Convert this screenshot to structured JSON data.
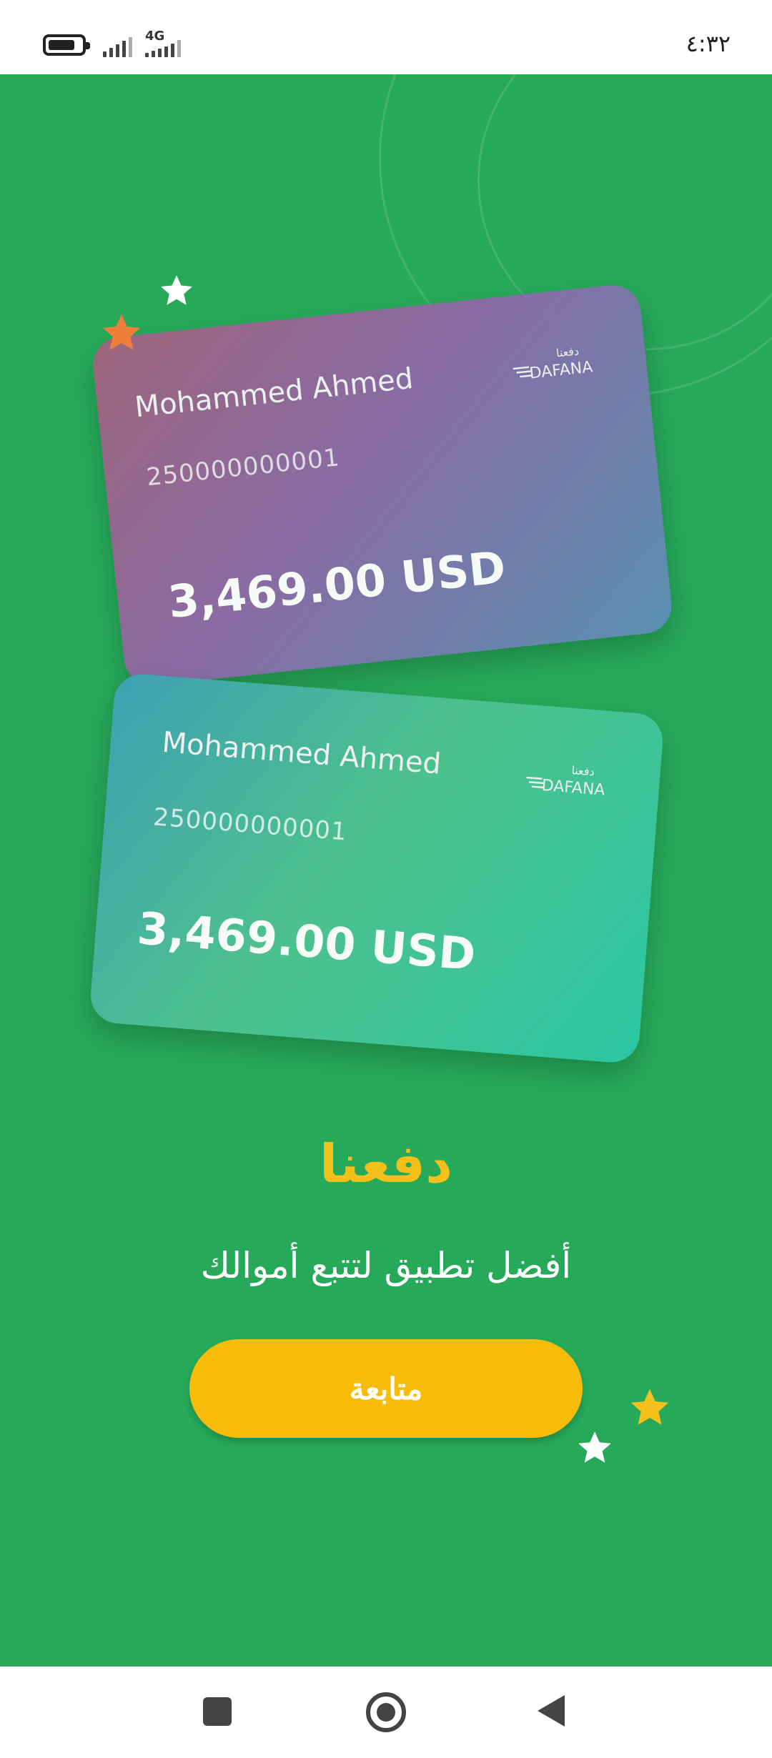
{
  "status_bar": {
    "network": "4G",
    "time": "٤:٣٢"
  },
  "cards": [
    {
      "holder_name": "Mohammed Ahmed",
      "account_number": "250000000001",
      "balance": "3,469.00 USD",
      "logo_text": "DAFANA",
      "logo_arabic": "دفعنا"
    },
    {
      "holder_name": "Mohammed Ahmed",
      "account_number": "250000000001",
      "balance": "3,469.00 USD",
      "logo_text": "DAFANA",
      "logo_arabic": "دفعنا"
    }
  ],
  "onboarding": {
    "title": "دفعنا",
    "tagline": "أفضل تطبيق لتتبع أموالك",
    "continue_label": "متابعة"
  },
  "colors": {
    "background": "#27a95a",
    "accent": "#f8bc0b",
    "title": "#f5c01a"
  },
  "icons": {
    "stars": [
      "white-star-icon",
      "orange-star-icon",
      "yellow-star-icon",
      "white-star-icon"
    ],
    "nav": [
      "recent-apps-icon",
      "home-icon",
      "back-icon"
    ]
  }
}
